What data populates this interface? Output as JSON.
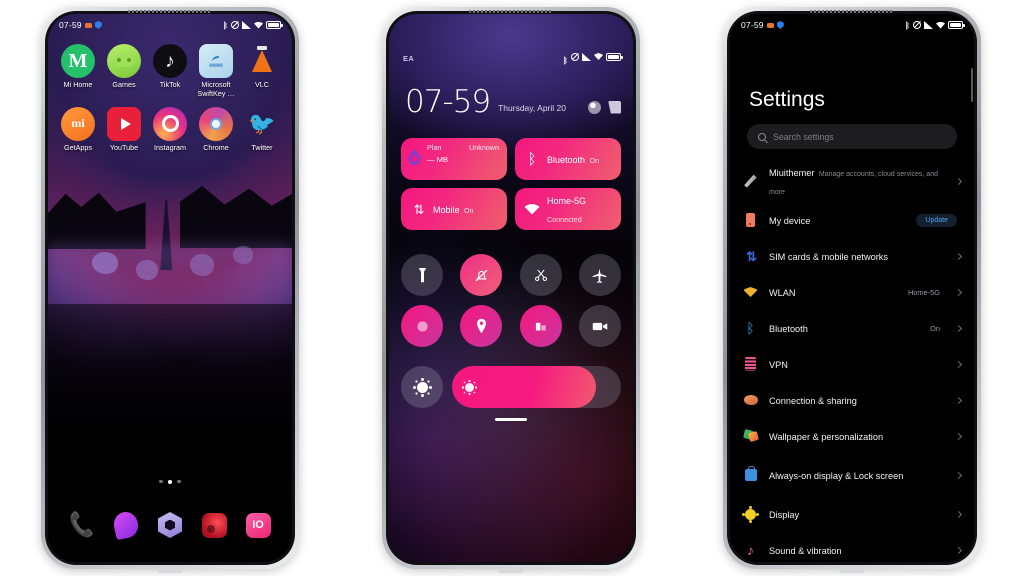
{
  "page": {
    "background": "#ffffff"
  },
  "phone1": {
    "name": "home-screen",
    "status": {
      "time": "07-59",
      "icons": [
        "dot-orange",
        "shield-icon",
        "bluetooth-icon",
        "dnd-icon",
        "signal-icon",
        "wifi-icon",
        "battery-icon"
      ]
    },
    "apps_row1": [
      {
        "label": "Mi Home",
        "icon": "mi-home-icon"
      },
      {
        "label": "Games",
        "icon": "games-icon"
      },
      {
        "label": "TikTok",
        "icon": "tiktok-icon"
      },
      {
        "label": "Microsoft SwiftKey …",
        "icon": "swiftkey-icon"
      },
      {
        "label": "VLC",
        "icon": "vlc-icon"
      }
    ],
    "apps_row2": [
      {
        "label": "GetApps",
        "icon": "getapps-icon"
      },
      {
        "label": "YouTube",
        "icon": "youtube-icon"
      },
      {
        "label": "Instagram",
        "icon": "instagram-icon"
      },
      {
        "label": "Chrome",
        "icon": "chrome-icon"
      },
      {
        "label": "Twitter",
        "icon": "twitter-icon"
      }
    ],
    "page_indicator": {
      "count": 3,
      "active": 1
    },
    "dock": [
      {
        "icon": "phone-icon"
      },
      {
        "icon": "messages-icon"
      },
      {
        "icon": "browser-hex-icon"
      },
      {
        "icon": "camera-icon"
      },
      {
        "icon": "gallery-icon"
      }
    ]
  },
  "phone2": {
    "name": "control-center",
    "status": {
      "carrier": "EA",
      "icons": [
        "bluetooth-icon",
        "dnd-icon",
        "signal-icon",
        "wifi-icon",
        "battery-icon"
      ]
    },
    "clock": {
      "time": "07-59",
      "date": "Thursday, April 20"
    },
    "header_actions": [
      {
        "icon": "gear-icon"
      },
      {
        "icon": "edit-icon"
      }
    ],
    "tiles": [
      {
        "name": "data-usage",
        "icon": "data-drop-icon",
        "plan": "Plan",
        "status": "Unknown",
        "amount": "— MB"
      },
      {
        "name": "bluetooth",
        "icon": "bluetooth-icon",
        "title": "Bluetooth",
        "sub": "On"
      },
      {
        "name": "mobile-data",
        "icon": "mobile-data-icon",
        "title": "Mobile",
        "sub": "On"
      },
      {
        "name": "wlan",
        "icon": "wifi-icon",
        "title": "Home-5G",
        "sub": "Connected"
      }
    ],
    "toggles_row1": [
      {
        "name": "flashlight",
        "icon": "flashlight-icon",
        "state": "off"
      },
      {
        "name": "silent",
        "icon": "bell-mute-icon",
        "state": "on"
      },
      {
        "name": "screenshot",
        "icon": "scissors-icon",
        "state": "off"
      },
      {
        "name": "airplane",
        "icon": "airplane-icon",
        "state": "off"
      }
    ],
    "toggles_row2": [
      {
        "name": "dnd",
        "icon": "moon-icon",
        "state": "on"
      },
      {
        "name": "location",
        "icon": "location-icon",
        "state": "on"
      },
      {
        "name": "data-saver",
        "icon": "chart-icon",
        "state": "on"
      },
      {
        "name": "screen-record",
        "icon": "video-icon",
        "state": "off"
      }
    ],
    "brightness": {
      "icon": "sun-icon",
      "percent": 85
    },
    "handle": "drag-handle"
  },
  "phone3": {
    "name": "settings-screen",
    "status": {
      "time": "07-59",
      "icons": [
        "dot-orange",
        "shield-icon",
        "bluetooth-icon",
        "dnd-icon",
        "signal-icon",
        "wifi-icon",
        "battery-icon"
      ]
    },
    "title": "Settings",
    "search": {
      "placeholder": "Search settings",
      "icon": "search-icon"
    },
    "items": [
      {
        "label": "Miuithemer",
        "sub": "Manage accounts, cloud services, and more",
        "icon": "themer-icon",
        "value": "",
        "badge": "",
        "chevron": true
      },
      {
        "label": "My device",
        "sub": "",
        "icon": "device-icon",
        "value": "",
        "badge": "Update",
        "chevron": false
      },
      {
        "label": "SIM cards & mobile networks",
        "sub": "",
        "icon": "sim-icon",
        "value": "",
        "badge": "",
        "chevron": true
      },
      {
        "label": "WLAN",
        "sub": "",
        "icon": "wlan-icon",
        "value": "Home-5G",
        "badge": "",
        "chevron": true
      },
      {
        "label": "Bluetooth",
        "sub": "",
        "icon": "bluetooth-icon",
        "value": "On",
        "badge": "",
        "chevron": true
      },
      {
        "label": "VPN",
        "sub": "",
        "icon": "vpn-icon",
        "value": "",
        "badge": "",
        "chevron": true
      },
      {
        "label": "Connection & sharing",
        "sub": "",
        "icon": "connection-icon",
        "value": "",
        "badge": "",
        "chevron": true
      },
      {
        "label": "Wallpaper & personalization",
        "sub": "",
        "icon": "wallpaper-icon",
        "value": "",
        "badge": "",
        "chevron": true
      },
      {
        "label": "Always-on display & Lock screen",
        "sub": "",
        "icon": "aod-icon",
        "value": "",
        "badge": "",
        "chevron": true
      },
      {
        "label": "Display",
        "sub": "",
        "icon": "display-icon",
        "value": "",
        "badge": "",
        "chevron": true
      },
      {
        "label": "Sound & vibration",
        "sub": "",
        "icon": "sound-icon",
        "value": "",
        "badge": "",
        "chevron": true
      }
    ]
  }
}
